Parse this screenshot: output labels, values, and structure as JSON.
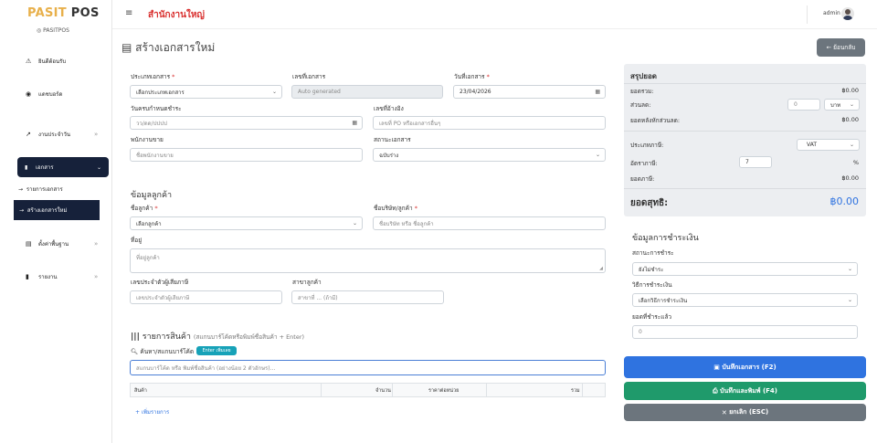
{
  "sidebar": {
    "brand_left": "PASIT",
    "brand_right": "POS",
    "brand_sub": "PASITPOS",
    "items": {
      "dashboard": "ยินดีต้อนรับ",
      "board": "แดชบอร์ด",
      "daily": "งานประจำวัน",
      "documents": "เอกสาร",
      "doc_list": "รายการเอกสาร",
      "doc_new": "สร้างเอกสารใหม่",
      "settings": "ตั้งค่าพื้นฐาน",
      "reports": "รายงาน"
    }
  },
  "topbar": {
    "branch": "สำนักงานใหญ่",
    "user": "admin"
  },
  "page": {
    "title": "สร้างเอกสารใหม่",
    "back_label": "ย้อนกลับ"
  },
  "form": {
    "doc_type_label": "ประเภทเอกสาร",
    "doc_type_value": "เลือกประเภทเอกสาร",
    "doc_no_label": "เลขที่เอกสาร",
    "doc_no_placeholder": "Auto generated",
    "doc_date_label": "วันที่เอกสาร",
    "doc_date_value": "23/04/2026",
    "due_date_label": "วันครบกำหนดชำระ",
    "due_date_placeholder": "วว/ดด/ปปปป",
    "ref_label": "เลขที่อ้างอิง",
    "ref_placeholder": "เลขที่ PO หรือเอกสารอื่นๆ",
    "sales_label": "พนักงานขาย",
    "sales_placeholder": "ชื่อพนักงานขาย",
    "status_label": "สถานะเอกสาร",
    "status_value": "ฉบับร่าง"
  },
  "customer": {
    "section": "ข้อมูลลูกค้า",
    "name_label": "ชื่อลูกค้า",
    "name_value": "เลือกลูกค้า",
    "company_label": "ชื่อบริษัท/ลูกค้า",
    "company_placeholder": "ชื่อบริษัท หรือ ชื่อลูกค้า",
    "address_label": "ที่อยู่",
    "address_placeholder": "ที่อยู่ลูกค้า",
    "tax_label": "เลขประจำตัวผู้เสียภาษี",
    "tax_placeholder": "เลขประจำตัวผู้เสียภาษี",
    "branch_label": "สาขาลูกค้า",
    "branch_placeholder": "สาขาที่ ... (ถ้ามี)"
  },
  "items": {
    "section": "รายการสินค้า",
    "section_hint": "(สแกนบาร์โค้ดหรือพิมพ์ชื่อสินค้า + Enter)",
    "search_label": "ค้นหา/สแกนบาร์โค้ด",
    "enter_badge": "Enter เพิ่มเลย",
    "search_placeholder": "สแกนบาร์โค้ด หรือ พิมพ์ชื่อสินค้า (อย่างน้อย 2 ตัวอักษร)...",
    "columns": [
      "สินค้า",
      "จำนวน",
      "ราคาต่อหน่วย",
      "รวม"
    ],
    "add_row": "เพิ่มรายการ"
  },
  "summary": {
    "title": "สรุปยอด",
    "subtotal_label": "ยอดรวม:",
    "subtotal_value": "฿0.00",
    "discount_label": "ส่วนลด:",
    "discount_value": "0",
    "discount_unit": "บาท",
    "after_discount_label": "ยอดหลังหักส่วนลด:",
    "after_discount_value": "฿0.00",
    "tax_type_label": "ประเภทภาษี:",
    "tax_type_value": "VAT",
    "tax_rate_label": "อัตราภาษี:",
    "tax_rate_value": "7",
    "tax_rate_unit": "%",
    "tax_amount_label": "ยอดภาษี:",
    "tax_amount_value": "฿0.00",
    "net_label": "ยอดสุทธิ:",
    "net_value": "฿0.00"
  },
  "payment": {
    "section": "ข้อมูลการชำระเงิน",
    "status_label": "สถานะการชำระ",
    "status_value": "ยังไม่ชำระ",
    "method_label": "วิธีการชำระเงิน",
    "method_value": "เลือกวิธีการชำระเงิน",
    "paid_label": "ยอดที่ชำระแล้ว",
    "paid_value": "0"
  },
  "actions": {
    "save": "บันทึกเอกสาร (F2)",
    "save_print": "บันทึกและพิมพ์ (F4)",
    "cancel": "ยกเลิก (ESC)"
  },
  "colors": {
    "save": "#2f73e0",
    "save_print": "#1f9a6b",
    "cancel": "#6c757d",
    "net": "#2f73e0"
  }
}
